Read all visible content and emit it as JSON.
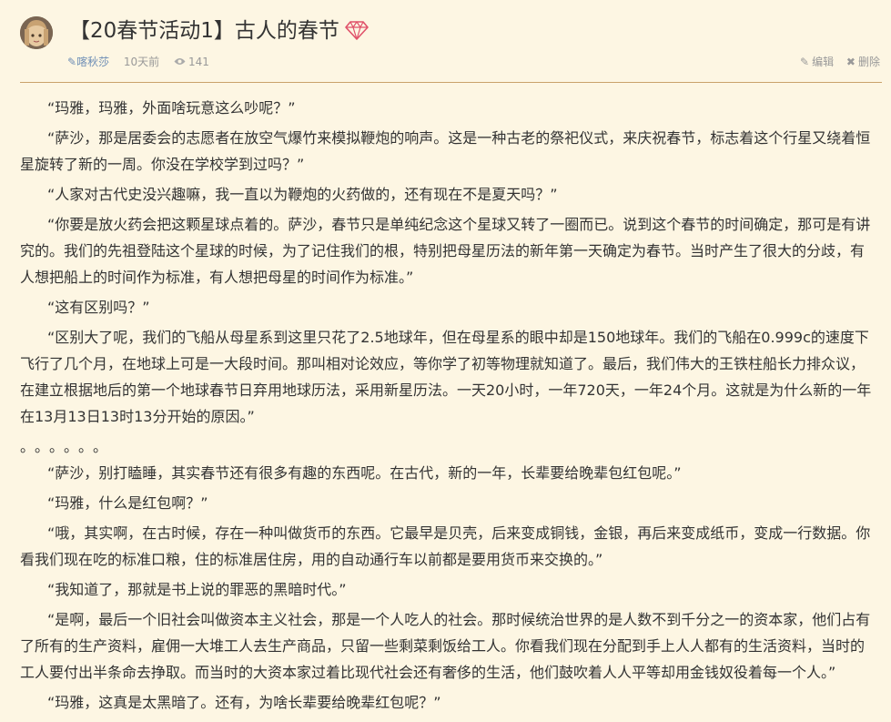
{
  "post": {
    "title": "【20春节活动1】古人的春节",
    "author": "喀秋莎",
    "time": "10天前",
    "views": "141"
  },
  "actions": {
    "edit_label": "编辑",
    "delete_label": "删除"
  },
  "paragraphs": [
    "“玛雅，玛雅，外面啥玩意这么吵呢？”",
    "“萨沙，那是居委会的志愿者在放空气爆竹来模拟鞭炮的响声。这是一种古老的祭祀仪式，来庆祝春节，标志着这个行星又绕着恒星旋转了新的一周。你没在学校学到过吗？”",
    "“人家对古代史没兴趣嘛，我一直以为鞭炮的火药做的，还有现在不是夏天吗？”",
    "“你要是放火药会把这颗星球点着的。萨沙，春节只是单纯纪念这个星球又转了一圈而已。说到这个春节的时间确定，那可是有讲究的。我们的先祖登陆这个星球的时候，为了记住我们的根，特别把母星历法的新年第一天确定为春节。当时产生了很大的分歧，有人想把船上的时间作为标准，有人想把母星的时间作为标准。”",
    "“这有区别吗？”",
    "“区别大了呢，我们的飞船从母星系到这里只花了2.5地球年，但在母星系的眼中却是150地球年。我们的飞船在0.999c的速度下飞行了几个月，在地球上可是一大段时间。那叫相对论效应，等你学了初等物理就知道了。最后，我们伟大的王铁柱船长力排众议，在建立根据地后的第一个地球春节日弃用地球历法，采用新星历法。一天20小时，一年720天，一年24个月。这就是为什么新的一年在13月13日13时13分开始的原因。”",
    "。。。。。。",
    "“萨沙，别打瞌睡，其实春节还有很多有趣的东西呢。在古代，新的一年，长辈要给晚辈包红包呢。”",
    "“玛雅，什么是红包啊？”",
    "“哦，其实啊，在古时候，存在一种叫做货币的东西。它最早是贝壳，后来变成铜钱，金银，再后来变成纸币，变成一行数据。你看我们现在吃的标准口粮，住的标准居住房，用的自动通行车以前都是要用货币来交换的。”",
    "“我知道了，那就是书上说的罪恶的黑暗时代。”",
    "“是啊，最后一个旧社会叫做资本主义社会，那是一个人吃人的社会。那时候统治世界的是人数不到千分之一的资本家，他们占有了所有的生产资料，雇佣一大堆工人去生产商品，只留一些剩菜剩饭给工人。你看我们现在分配到手上人人都有的生活资料，当时的工人要付出半条命去挣取。而当时的大资本家过着比现代社会还有奢侈的生活，他们鼓吹着人人平等却用金钱奴役着每一个人。”",
    "“玛雅，这真是太黑暗了。还有，为啥长辈要给晚辈红包呢？”"
  ],
  "colors": {
    "background": "#fdf6e3",
    "divider": "#c9a26b",
    "author_link": "#6d8db5",
    "gem": "#e0526a"
  },
  "icons": {
    "gem": "gem-icon",
    "author": "pen-icon",
    "views": "eye-icon",
    "edit": "edit-icon",
    "delete": "close-icon"
  }
}
